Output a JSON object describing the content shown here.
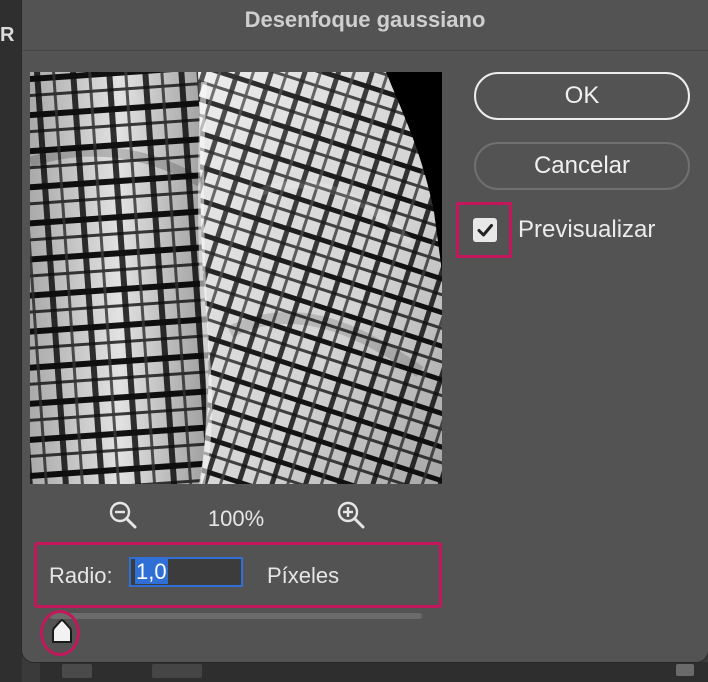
{
  "dialog": {
    "title": "Desenfoque gaussiano"
  },
  "background": {
    "left_letter": "R"
  },
  "buttons": {
    "ok_label": "OK",
    "cancel_label": "Cancelar"
  },
  "preview_checkbox": {
    "label": "Previsualizar",
    "checked": true
  },
  "preview": {
    "zoom_level": "100%",
    "zoom_out_icon": "zoom-out-icon",
    "zoom_in_icon": "zoom-in-icon"
  },
  "radius": {
    "label": "Radio:",
    "value": "1,0",
    "unit": "Píxeles",
    "slider_value": 0.0
  },
  "colors": {
    "highlight": "#c2185b",
    "input_focus": "#2f6fd6",
    "dialog_bg": "#535353"
  }
}
